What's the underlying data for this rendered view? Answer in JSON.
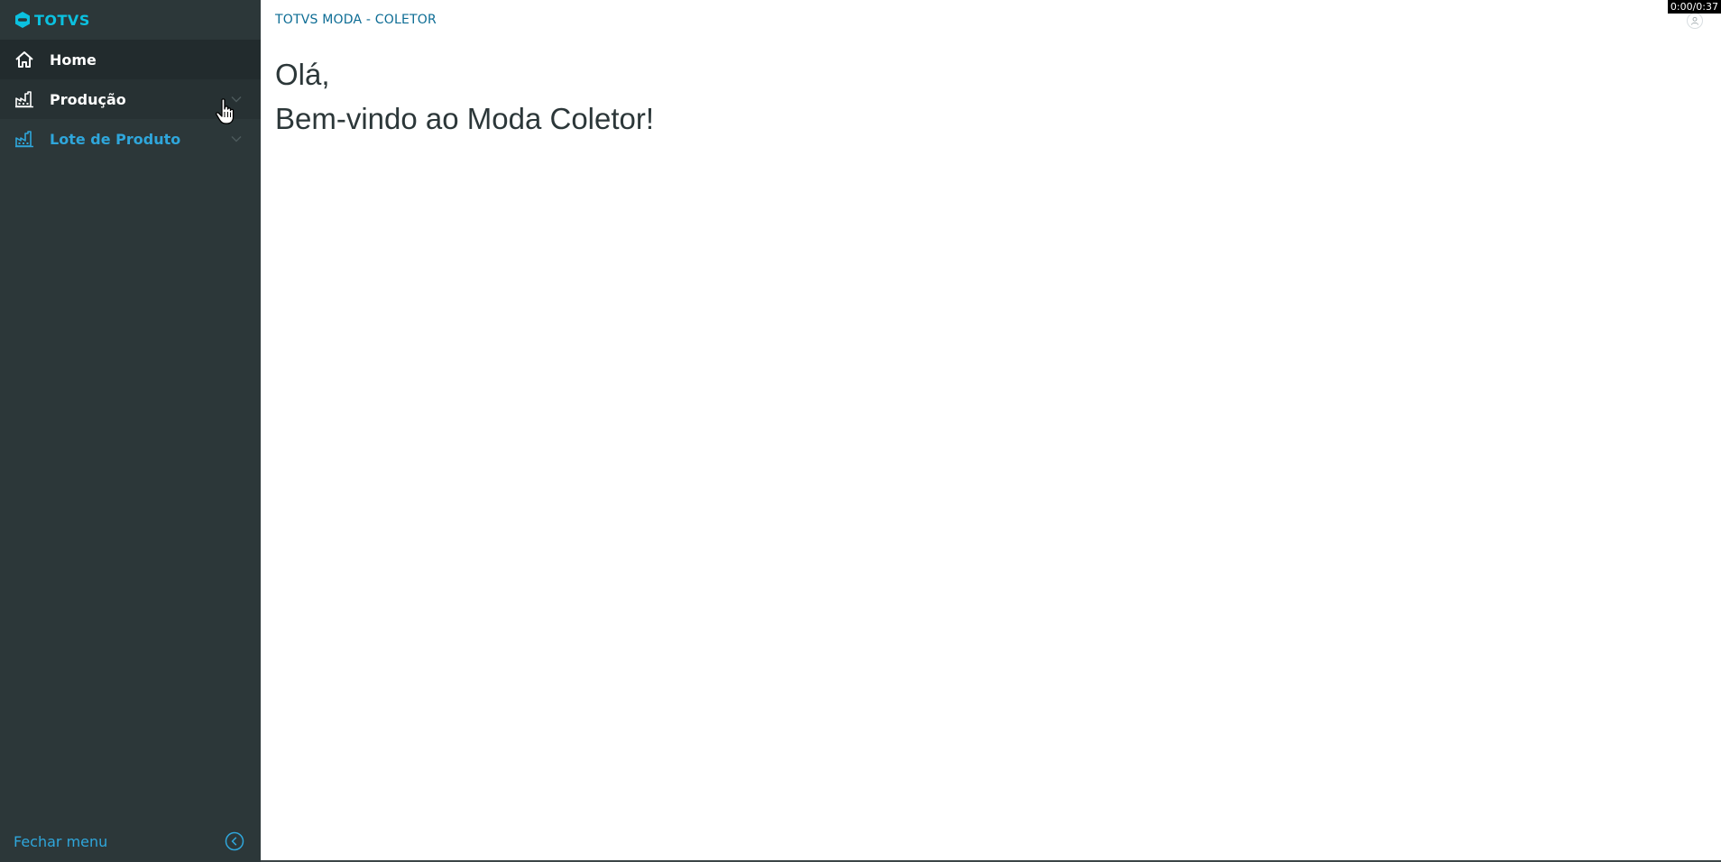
{
  "brand": {
    "logo_text": "TOTVS",
    "accent_color": "#0bc1e0"
  },
  "sidebar": {
    "items": [
      {
        "label": "Home",
        "icon": "home-icon"
      },
      {
        "label": "Produção",
        "icon": "factory-icon"
      },
      {
        "label": "Lote de Produto",
        "icon": "factory-icon"
      }
    ],
    "close_label": "Fechar menu",
    "close_icon": "chevron-left-circle-icon"
  },
  "header": {
    "title": "TOTVS MODA - COLETOR",
    "user_icon": "user-icon"
  },
  "main": {
    "greeting_line1": "Olá,",
    "greeting_line2": "Bem-vindo ao Moda Coletor!"
  },
  "video": {
    "timer": "0:00/0:37"
  }
}
